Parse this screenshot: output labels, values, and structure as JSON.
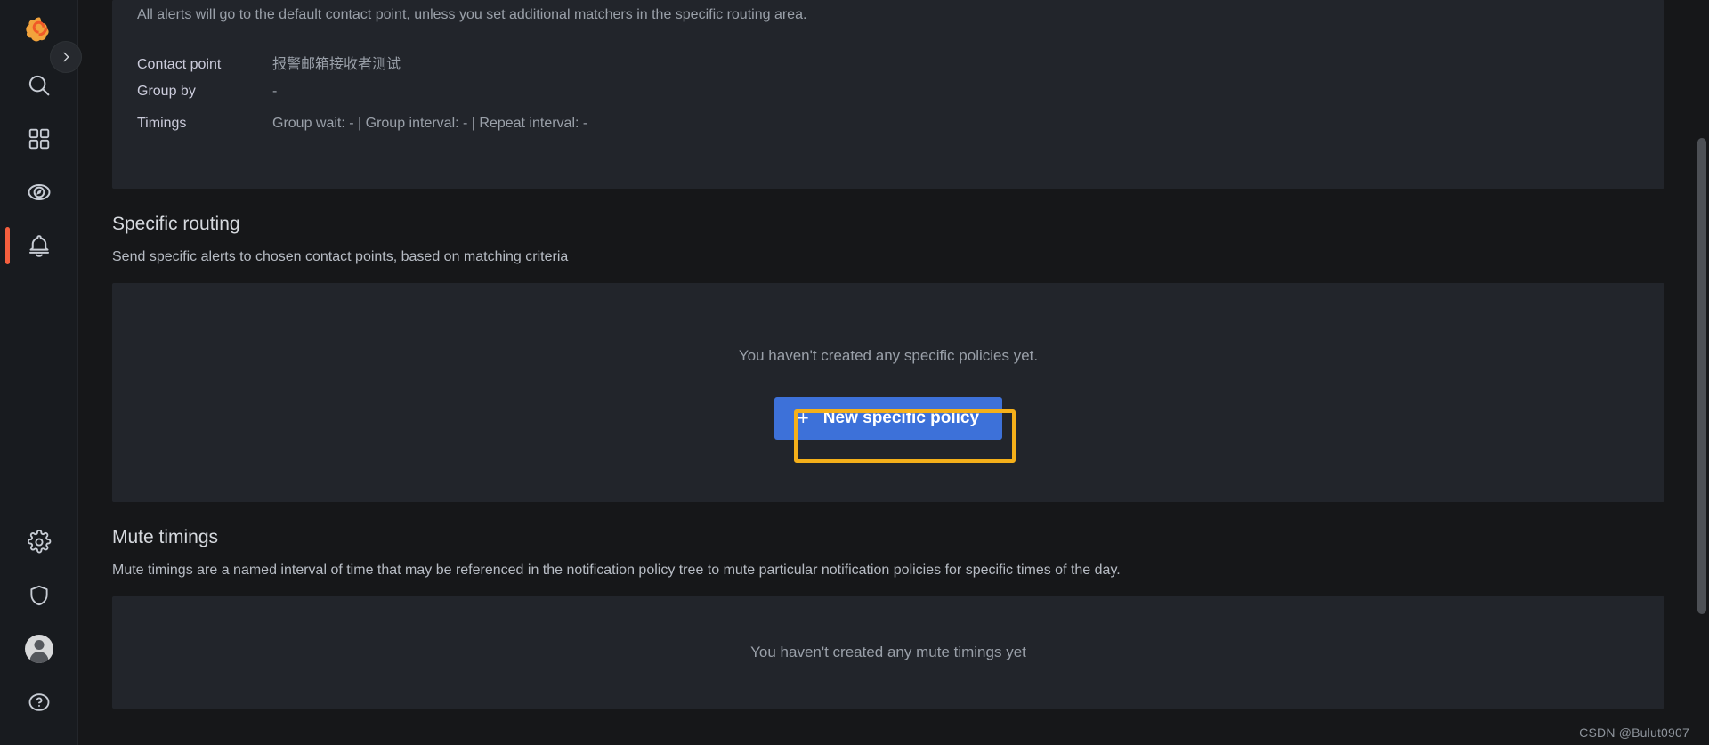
{
  "nav": {
    "logo_label": "grafana-logo-icon",
    "toggle_label": "expand-menu-chevron",
    "items_top": [
      {
        "id": "search",
        "label": "Search",
        "icon": "search-icon"
      },
      {
        "id": "dashboards",
        "label": "Dashboards",
        "icon": "apps-grid-icon"
      },
      {
        "id": "explore",
        "label": "Explore",
        "icon": "compass-icon"
      },
      {
        "id": "alerting",
        "label": "Alerting",
        "icon": "bell-icon",
        "active": true
      }
    ],
    "items_bottom": [
      {
        "id": "configuration",
        "label": "Configuration",
        "icon": "gear-icon"
      },
      {
        "id": "server-admin",
        "label": "Server Admin",
        "icon": "shield-icon"
      },
      {
        "id": "profile",
        "label": "Profile",
        "icon": "avatar-icon"
      },
      {
        "id": "help",
        "label": "Help",
        "icon": "question-circle-icon"
      }
    ]
  },
  "default_policy": {
    "description": "All alerts will go to the default contact point, unless you set additional matchers in the specific routing area.",
    "rows": [
      {
        "key": "Contact point",
        "value": "报警邮箱接收者测试"
      },
      {
        "key": "Group by",
        "value": "-"
      },
      {
        "key": "Timings",
        "value": "Group wait: - | Group interval: - | Repeat interval: -"
      }
    ]
  },
  "specific_routing": {
    "title": "Specific routing",
    "subtitle": "Send specific alerts to chosen contact points, based on matching criteria",
    "empty_text": "You haven't created any specific policies yet.",
    "new_policy_button": "New specific policy",
    "plus_glyph": "+"
  },
  "mute_timings": {
    "title": "Mute timings",
    "subtitle": "Mute timings are a named interval of time that may be referenced in the notification policy tree to mute particular notification policies for specific times of the day.",
    "empty_text": "You haven't created any mute timings yet"
  },
  "watermark": "CSDN @Bulut0907",
  "colors": {
    "accent_blue": "#3d71d9",
    "highlight_yellow": "#f5b01a",
    "active_orange": "#f55f3e",
    "card_bg": "#22252b",
    "page_bg": "#161719",
    "rail_bg": "#181b1f"
  }
}
